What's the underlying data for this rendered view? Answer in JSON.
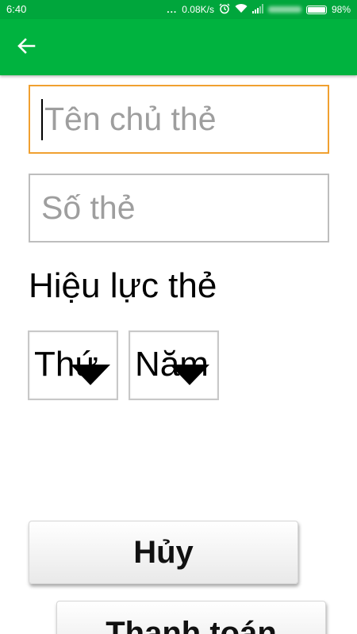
{
  "status_bar": {
    "time": "6:40",
    "dots": "...",
    "speed": "0.08K/s",
    "battery_percent": "98%",
    "battery_level": 0.98,
    "icons": [
      "alarm-icon",
      "wifi-icon",
      "signal-icon",
      "battery-icon"
    ]
  },
  "app_bar": {
    "back_icon": "arrow-left-icon",
    "color": "#00b33f"
  },
  "form": {
    "card_holder_placeholder": "Tên chủ thẻ",
    "card_number_placeholder": "Số thẻ",
    "expiry_label": "Hiệu lực thẻ",
    "month_select": "Thứ",
    "year_select": "Năm"
  },
  "buttons": {
    "cancel_label": "Hủy",
    "pay_label": "Thanh toán"
  },
  "colors": {
    "status_bar": "#00a63c",
    "app_bar": "#00b33f",
    "focus_border": "#f0a030"
  }
}
